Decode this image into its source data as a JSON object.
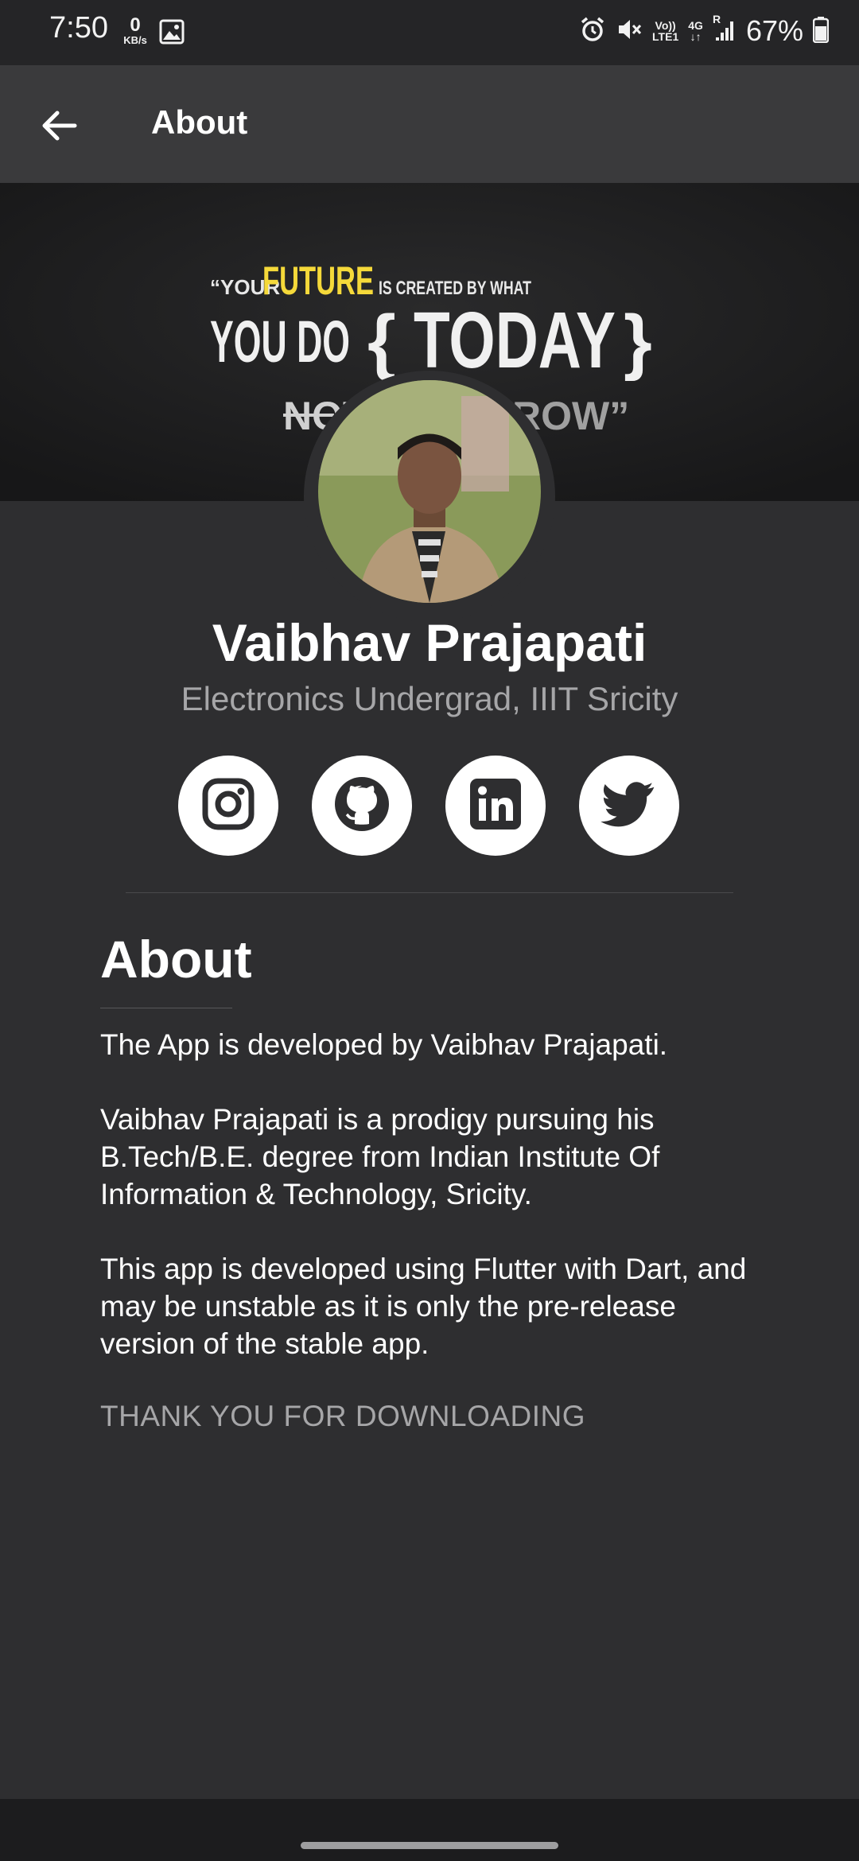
{
  "status_bar": {
    "time": "7:50",
    "net_speed_value": "0",
    "net_speed_unit": "KB/s",
    "volte_top": "Vo))",
    "volte_bottom": "LTE1",
    "network_type": "4G",
    "roaming": "R",
    "battery": "67%"
  },
  "app_bar": {
    "title": "About"
  },
  "banner": {
    "quote_open": "“YOUR",
    "highlight": "FUTURE",
    "line1_rest": "IS CREATED BY WHAT",
    "line2": "YOU DO",
    "brace_open": "{",
    "big_word": "TODAY",
    "brace_close": "}",
    "line3_left": "NOT",
    "line3_right": "ROW”",
    "highlight_color": "#f5d93a"
  },
  "profile": {
    "name": "Vaibhav Prajapati",
    "subtitle": "Electronics Undergrad, IIIT Sricity"
  },
  "socials": [
    "instagram-icon",
    "github-icon",
    "linkedin-icon",
    "twitter-icon"
  ],
  "about": {
    "heading": "About",
    "p1": "The App is developed by Vaibhav Prajapati.",
    "p2": "Vaibhav Prajapati is a prodigy pursuing his B.Tech/B.E. degree from Indian Institute Of Information & Technology, Sricity.",
    "p3": "This app is developed using Flutter with Dart, and may be unstable as it is only the pre-release version of the stable app.",
    "thanks": "THANK YOU FOR DOWNLOADING"
  }
}
